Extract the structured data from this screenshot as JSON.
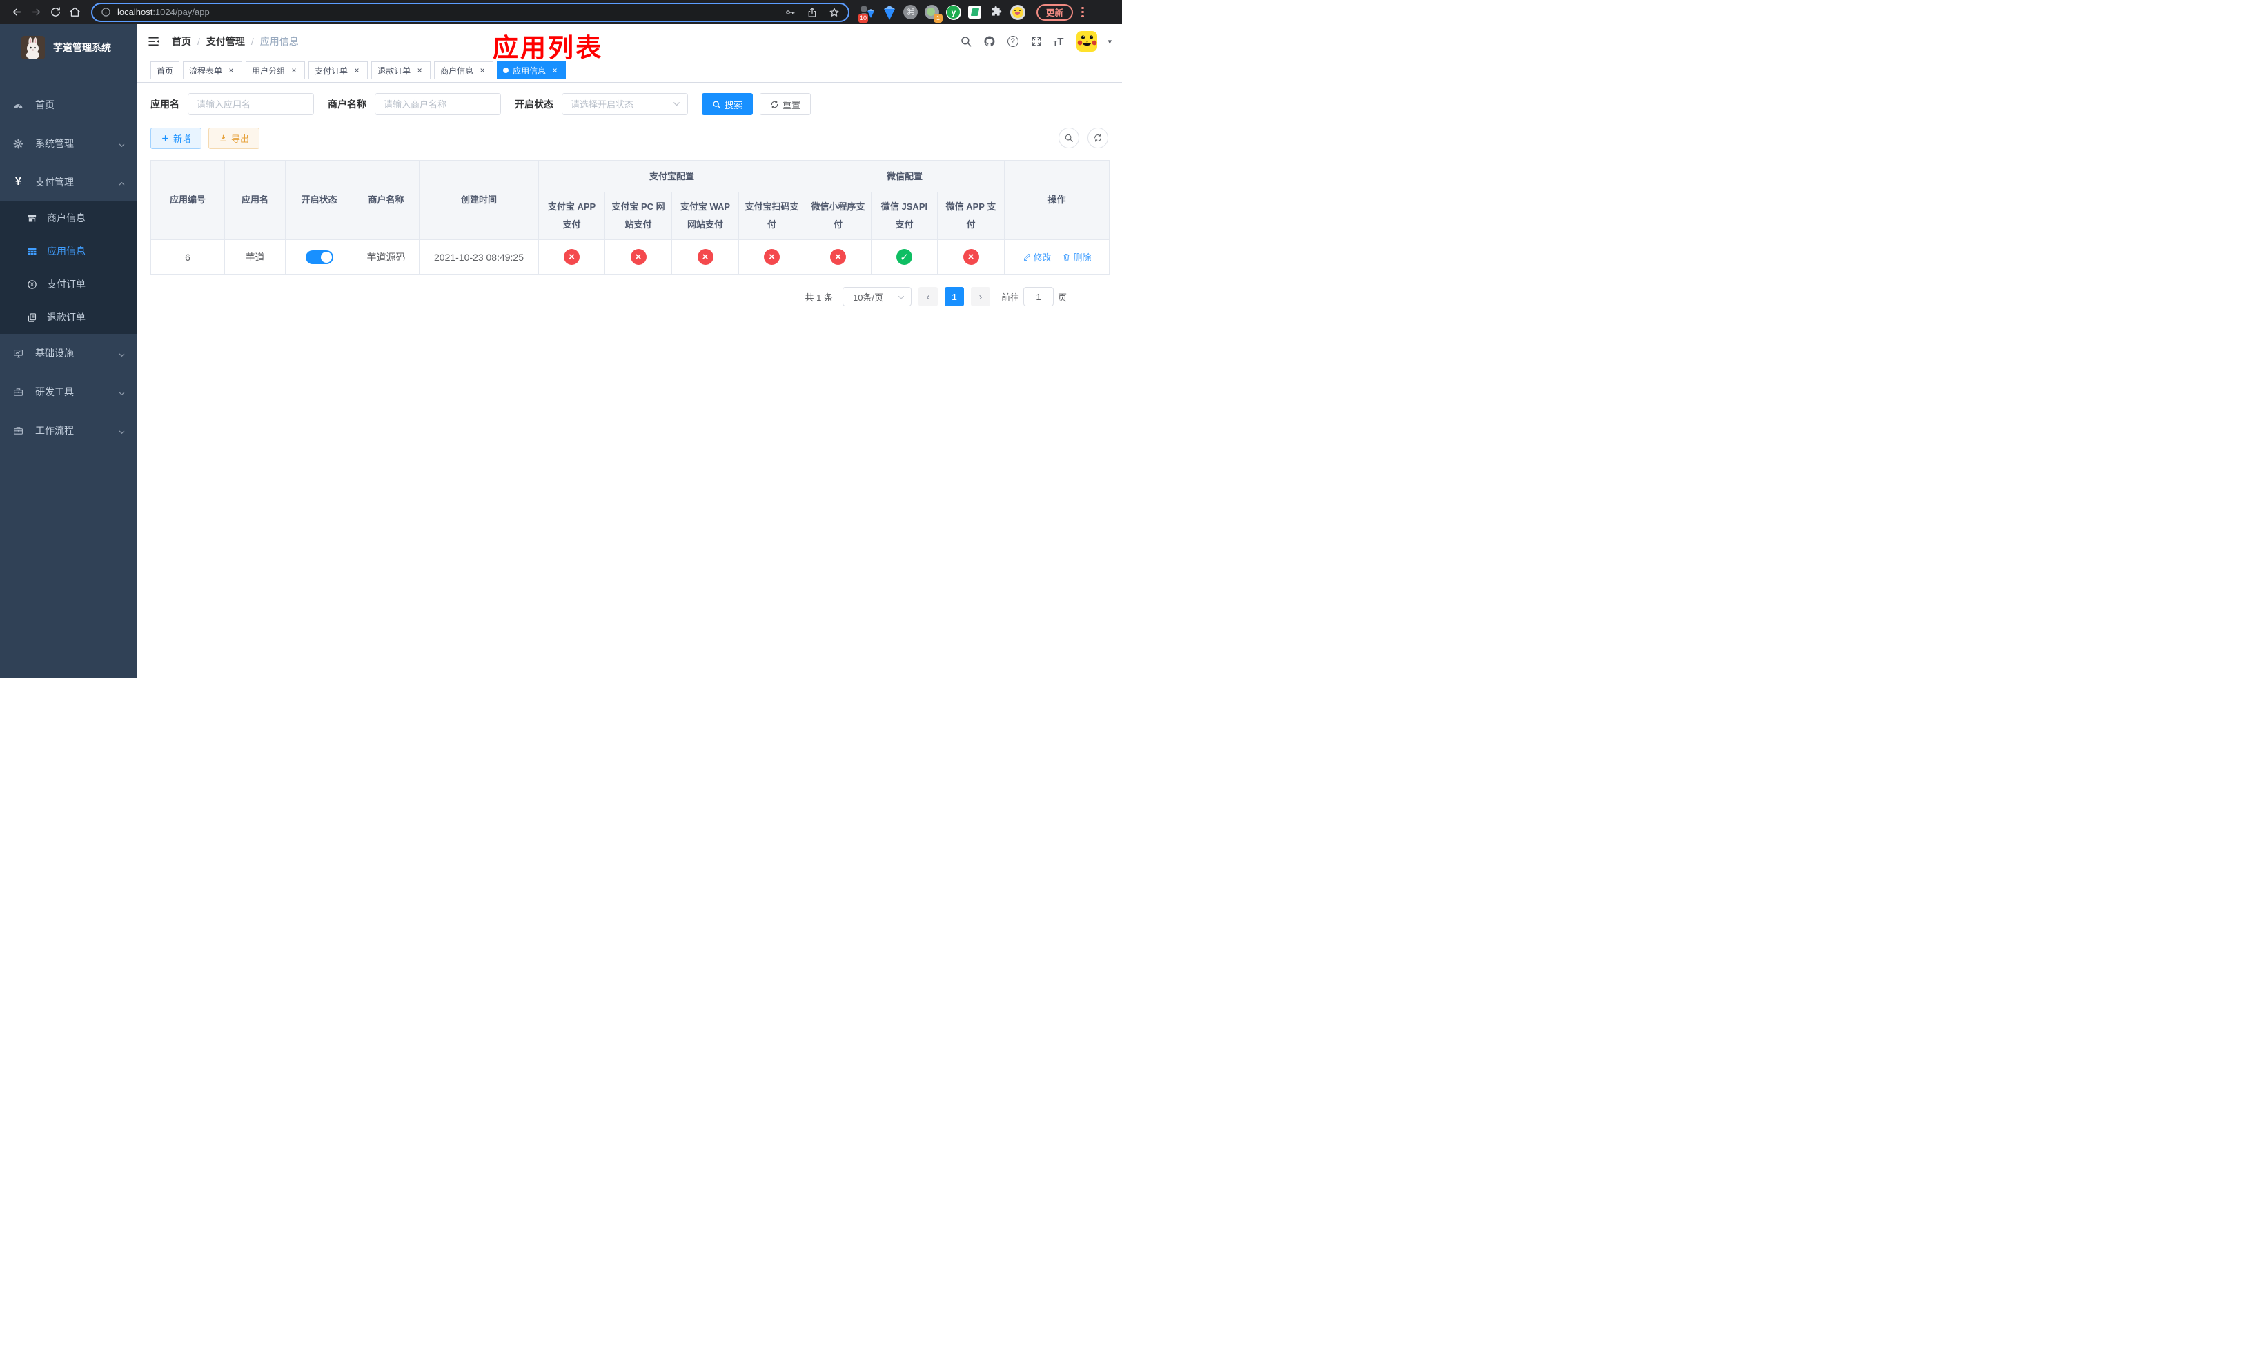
{
  "colors": {
    "primary": "#1890ff",
    "link": "#409eff",
    "status_on": "#0fbe63",
    "status_off": "#f4494d",
    "warning_text": "#e6a23c",
    "warning_bg": "#fdf6ec",
    "warning_border": "#f5dab1",
    "primary_plain_bg": "#e8f4ff",
    "primary_plain_border": "#a3d3ff",
    "sidebar_bg": "#304156",
    "sidebar_sub_bg": "#1f2d3d",
    "sidebar_text": "#bfcbd9",
    "sidebar_active": "#409eff",
    "chrome_bg": "#202124",
    "annotation": "#ff0000",
    "tag_active_bg": "#1890ff"
  },
  "glyphs": {
    "check": "✓",
    "cross": "×",
    "close": "×",
    "caret_down": "▾",
    "prev": "‹",
    "next": "›",
    "question": "?",
    "command": "⌘",
    "y_logo": "y"
  },
  "browser": {
    "url_host": "localhost",
    "url_path": ":1024/pay/app",
    "update_button": "更新",
    "ext_badge_blocks": "10",
    "ext_badge_circle": "1"
  },
  "sidebar": {
    "title": "芋道管理系统",
    "items": [
      {
        "label": "首页"
      },
      {
        "label": "系统管理"
      },
      {
        "label": "支付管理"
      },
      {
        "label": "商户信息"
      },
      {
        "label": "应用信息"
      },
      {
        "label": "支付订单"
      },
      {
        "label": "退款订单"
      },
      {
        "label": "基础设施"
      },
      {
        "label": "研发工具"
      },
      {
        "label": "工作流程"
      }
    ]
  },
  "navbar": {
    "breadcrumb": {
      "items": [
        "首页",
        "支付管理",
        "应用信息"
      ],
      "separator": "/"
    },
    "annotation": "应用列表"
  },
  "tabs": {
    "items": [
      {
        "label": "首页"
      },
      {
        "label": "流程表单"
      },
      {
        "label": "用户分组"
      },
      {
        "label": "支付订单"
      },
      {
        "label": "退款订单"
      },
      {
        "label": "商户信息"
      },
      {
        "label": "应用信息"
      }
    ]
  },
  "filters": {
    "app_name": {
      "label": "应用名",
      "placeholder": "请输入应用名"
    },
    "merchant_name": {
      "label": "商户名称",
      "placeholder": "请输入商户名称"
    },
    "status": {
      "label": "开启状态",
      "placeholder": "请选择开启状态"
    },
    "search_button": "搜索",
    "reset_button": "重置"
  },
  "toolbar": {
    "add_button": "新增",
    "export_button": "导出"
  },
  "table": {
    "groups": {
      "alipay": "支付宝配置",
      "wechat": "微信配置"
    },
    "columns": [
      "应用编号",
      "应用名",
      "开启状态",
      "商户名称",
      "创建时间",
      "支付宝 APP 支付",
      "支付宝 PC 网站支付",
      "支付宝 WAP 网站支付",
      "支付宝扫码支付",
      "微信小程序支付",
      "微信 JSAPI 支付",
      "微信 APP 支付",
      "操作"
    ],
    "row": {
      "app_id": "6",
      "app_name": "芋道",
      "enabled": true,
      "merchant_name": "芋道源码",
      "created_at": "2021-10-23 08:49:25",
      "channels": [
        false,
        false,
        false,
        false,
        false,
        true,
        false
      ],
      "edit_label": "修改",
      "delete_label": "删除"
    }
  },
  "pagination": {
    "total": "共 1 条",
    "page_size": "10条/页",
    "current_page": "1",
    "goto_prefix": "前往",
    "goto_value": "1",
    "goto_suffix": "页"
  }
}
